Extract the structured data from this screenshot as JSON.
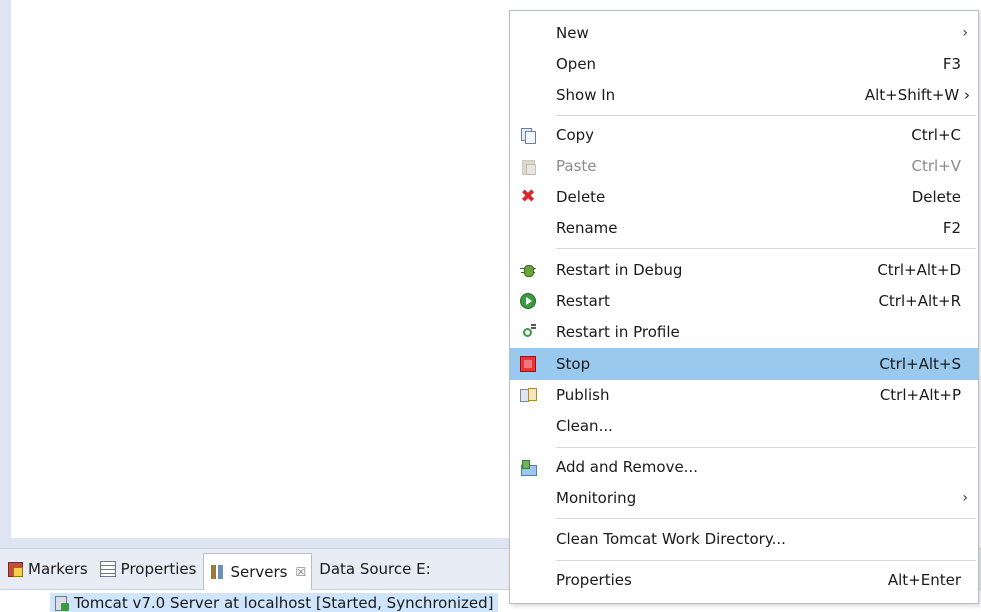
{
  "bottom_panel": {
    "tabs": [
      {
        "label": "Markers",
        "icon": "markers-icon"
      },
      {
        "label": "Properties",
        "icon": "properties-icon"
      },
      {
        "label": "Servers",
        "icon": "servers-icon",
        "close": "☒"
      },
      {
        "label": "Data Source E:",
        "icon": ""
      }
    ],
    "server_entry": "Tomcat v7.0 Server at localhost  [Started, Synchronized]"
  },
  "context_menu": {
    "items": [
      {
        "label": "New",
        "accel": "›",
        "icon": ""
      },
      {
        "label": "Open",
        "accel": "F3",
        "icon": ""
      },
      {
        "label": "Show In",
        "accel": "Alt+Shift+W ›",
        "icon": ""
      },
      {
        "label": "Copy",
        "accel": "Ctrl+C",
        "icon": "copy-icon"
      },
      {
        "label": "Paste",
        "accel": "Ctrl+V",
        "icon": "paste-icon",
        "state": "disabled"
      },
      {
        "label": "Delete",
        "accel": "Delete",
        "icon": "delete-icon"
      },
      {
        "label": "Rename",
        "accel": "F2",
        "icon": ""
      },
      {
        "label": "Restart in Debug",
        "accel": "Ctrl+Alt+D",
        "icon": "debug-bug-icon"
      },
      {
        "label": "Restart",
        "accel": "Ctrl+Alt+R",
        "icon": "restart-icon"
      },
      {
        "label": "Restart in Profile",
        "accel": "",
        "icon": "profile-icon"
      },
      {
        "label": "Stop",
        "accel": "Ctrl+Alt+S",
        "icon": "stop-icon",
        "state": "highlighted"
      },
      {
        "label": "Publish",
        "accel": "Ctrl+Alt+P",
        "icon": "publish-icon"
      },
      {
        "label": "Clean...",
        "accel": "",
        "icon": ""
      },
      {
        "label": "Add and Remove...",
        "accel": "",
        "icon": "add-remove-icon"
      },
      {
        "label": "Monitoring",
        "accel": "›",
        "icon": ""
      },
      {
        "label": "Clean Tomcat Work Directory...",
        "accel": "",
        "icon": ""
      },
      {
        "label": "Properties",
        "accel": "Alt+Enter",
        "icon": ""
      }
    ]
  },
  "colors": {
    "highlight": "#99c9ef",
    "stop_red": "#e8333a",
    "delete_red": "#d9272e",
    "selection_bg": "#cfe5fb"
  }
}
